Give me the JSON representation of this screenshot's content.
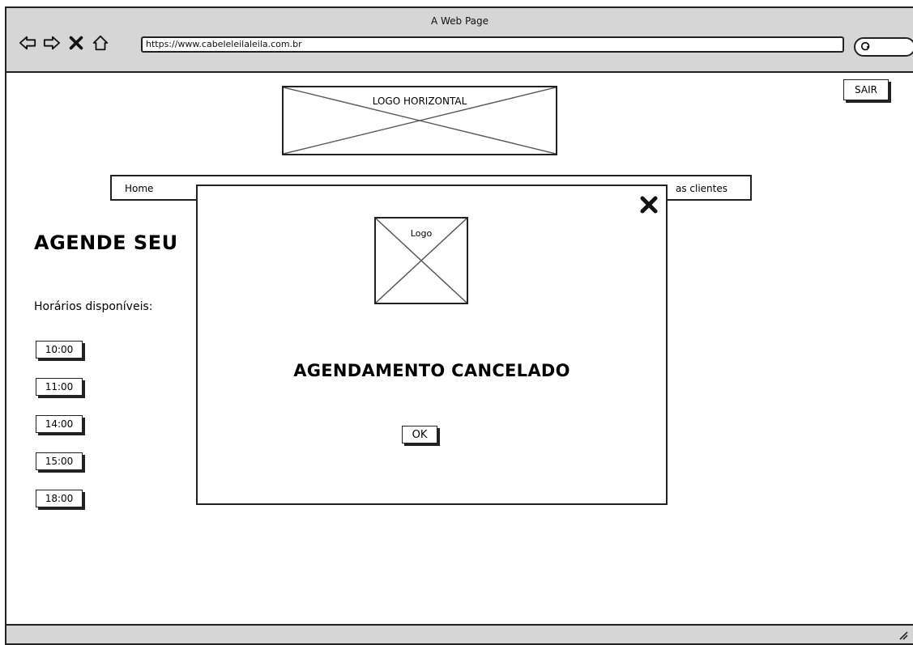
{
  "window": {
    "title": "A Web Page",
    "url": "https://www.cabeleleilaleila.com.br"
  },
  "icons": {
    "back": "back-arrow-icon",
    "forward": "forward-arrow-icon",
    "stop": "stop-icon",
    "home": "home-icon",
    "search": "search-icon",
    "close": "close-icon",
    "resize": "resize-grip-icon"
  },
  "header": {
    "sair_label": "SAIR",
    "logo_label": "LOGO HORIZONTAL"
  },
  "nav": {
    "home_label": "Home",
    "clientes_label": "as clientes"
  },
  "main": {
    "heading": "AGENDE SEU",
    "slots_label": "Horários disponíveis:",
    "slots": [
      "10:00",
      "11:00",
      "14:00",
      "15:00",
      "18:00"
    ]
  },
  "modal": {
    "logo_label": "Logo",
    "message": "AGENDAMENTO CANCELADO",
    "ok_label": "OK"
  }
}
